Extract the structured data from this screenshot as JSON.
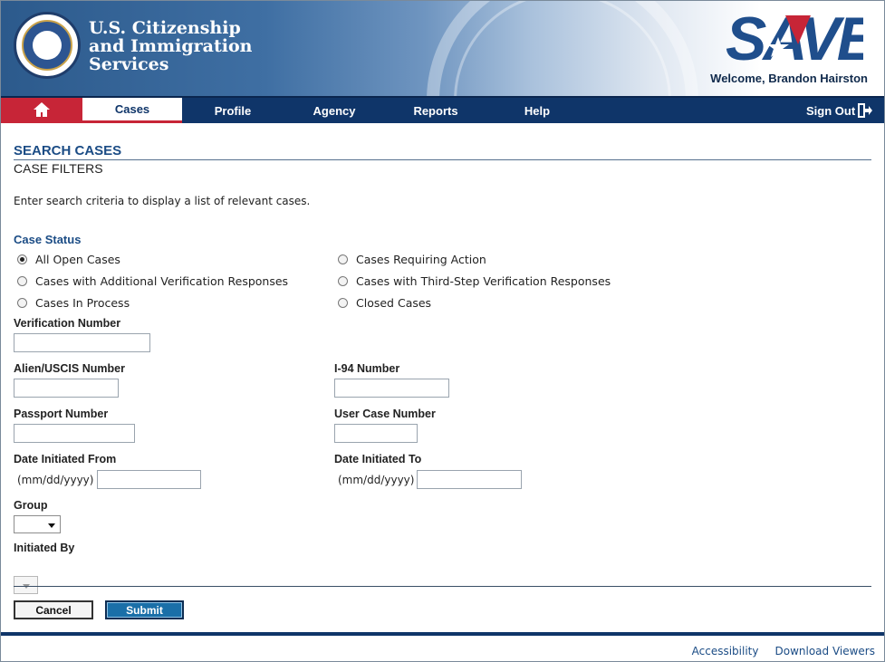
{
  "header": {
    "agency_line1": "U.S. Citizenship",
    "agency_line2": "and Immigration",
    "agency_line3": "Services",
    "logo_text": "SAVE",
    "welcome": "Welcome, Brandon Hairston"
  },
  "nav": {
    "home_icon": "home-icon",
    "tabs": [
      "Cases",
      "Profile",
      "Agency",
      "Reports",
      "Help"
    ],
    "active_tab": "Cases",
    "signout": "Sign Out"
  },
  "page": {
    "title": "SEARCH CASES",
    "section": "CASE FILTERS",
    "intro": "Enter search criteria to display a list of relevant cases."
  },
  "case_status": {
    "label": "Case Status",
    "options": [
      "All Open Cases",
      "Cases Requiring Action",
      "Cases with Additional Verification Responses",
      "Cases with Third-Step Verification Responses",
      "Cases In Process",
      "Closed Cases"
    ],
    "selected": "All Open Cases"
  },
  "fields": {
    "verification_number": "Verification Number",
    "alien_number": "Alien/USCIS Number",
    "i94_number": "I-94 Number",
    "passport_number": "Passport Number",
    "user_case_number": "User Case Number",
    "date_from": "Date Initiated From",
    "date_to": "Date Initiated To",
    "date_hint": "(mm/dd/yyyy)",
    "group": "Group",
    "initiated_by": "Initiated By"
  },
  "buttons": {
    "cancel": "Cancel",
    "submit": "Submit"
  },
  "footer": {
    "accessibility": "Accessibility",
    "download_viewers": "Download Viewers"
  },
  "colors": {
    "nav_bg": "#0f3569",
    "home_bg": "#c72537",
    "title_blue": "#1b4c85",
    "submit_bg": "#1a6fa8"
  }
}
